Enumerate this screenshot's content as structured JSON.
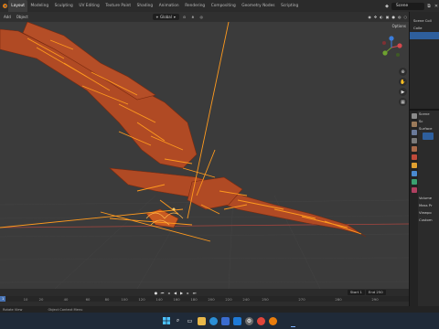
{
  "topbar": {
    "workspaces": [
      "Layout",
      "Modeling",
      "Sculpting",
      "UV Editing",
      "Texture Paint",
      "Shading",
      "Animation",
      "Rendering",
      "Compositing",
      "Geometry Nodes",
      "Scripting"
    ],
    "active_workspace": "Layout",
    "scene_name": "Scene"
  },
  "viewport_header": {
    "items": [
      "Add",
      "Object"
    ],
    "orientation": "Global",
    "options_label": "Options"
  },
  "outliner": {
    "rows": [
      "Scene Coll",
      "Colle",
      ""
    ]
  },
  "properties": {
    "rows": [
      "Scene",
      "Sc",
      "Surface",
      "",
      "Volume",
      "Mass Pr",
      "Viewpo",
      "Custom"
    ]
  },
  "timeline": {
    "current_frame": "1",
    "start_label": "Start",
    "start_value": "1",
    "end_label": "End",
    "end_value": "250",
    "ruler_labels": [
      "10",
      "20",
      "40",
      "60",
      "80",
      "100",
      "120",
      "140",
      "160",
      "180",
      "200",
      "220",
      "240",
      "250",
      "270",
      "280",
      "290"
    ]
  },
  "statusbar": {
    "items": [
      "Rotate View",
      "Object Context Menu"
    ]
  },
  "taskbar": {
    "icons": [
      "windows-start-icon",
      "search-icon",
      "task-view-icon",
      "folder-icon",
      "edge-icon",
      "store-icon",
      "mail-icon",
      "settings-icon",
      "chrome-icon",
      "blender-icon"
    ]
  },
  "colors": {
    "mesh_fill": "#b04a24",
    "bones": "#ff9a1e",
    "viewport_bg": "#3b3b3b",
    "x_axis": "#a8463f",
    "selection_blue": "#2e5f9d"
  }
}
